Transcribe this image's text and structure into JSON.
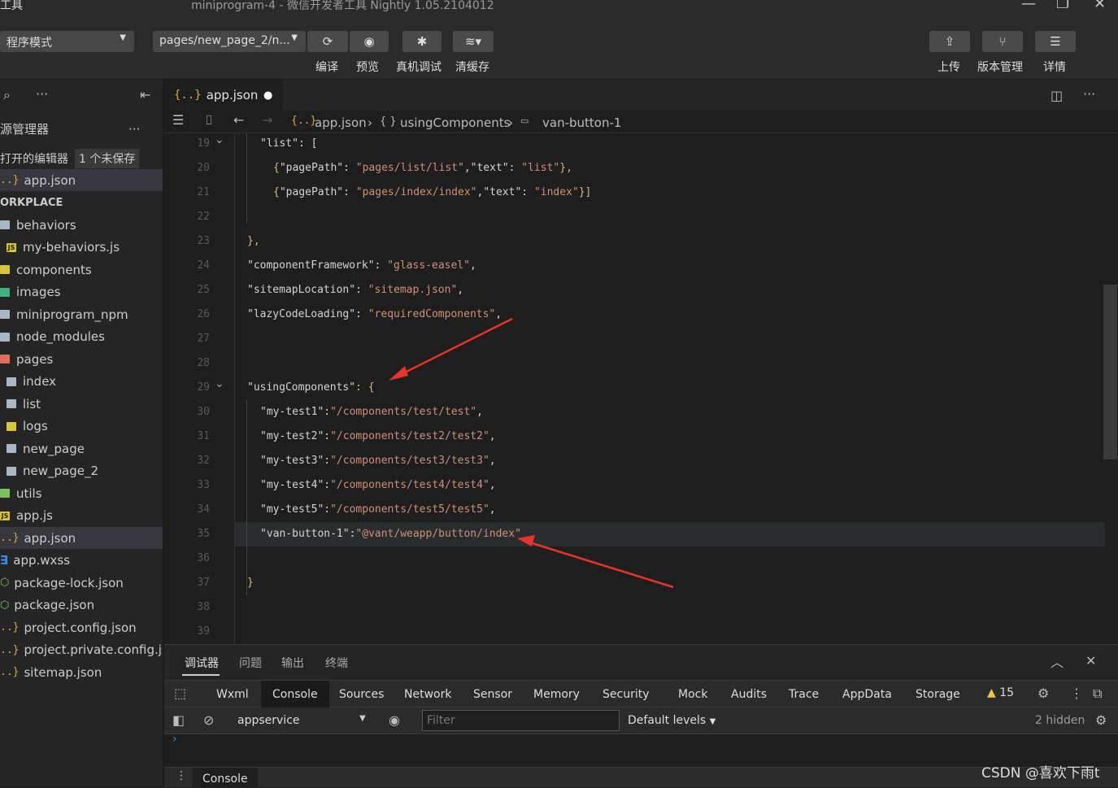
{
  "window": {
    "title_left": "工具",
    "title": "miniprogram-4 - 微信开发者工具 Nightly 1.05.2104012"
  },
  "toolbar": {
    "mode_select": "程序模式",
    "page_select": "pages/new_page_2/n...",
    "compile_label": "编译",
    "preview_label": "预览",
    "remote_debug_label": "真机调试",
    "clear_cache_label": "清缓存",
    "upload_label": "上传",
    "version_label": "版本管理",
    "details_label": "详情"
  },
  "sidebar": {
    "explorer_title": "源管理器",
    "open_editors_label": "打开的编辑器",
    "unsaved_badge": "1 个未保存",
    "open_file": "app.json",
    "workspace_label": "ORKPLACE",
    "items": [
      {
        "label": "behaviors",
        "type": "folder",
        "indent": 0
      },
      {
        "label": "my-behaviors.js",
        "type": "js",
        "indent": 1
      },
      {
        "label": "components",
        "type": "comp",
        "indent": 0
      },
      {
        "label": "images",
        "type": "img",
        "indent": 0
      },
      {
        "label": "miniprogram_npm",
        "type": "folder",
        "indent": 0
      },
      {
        "label": "node_modules",
        "type": "folder",
        "indent": 0
      },
      {
        "label": "pages",
        "type": "pg",
        "indent": 0
      },
      {
        "label": "index",
        "type": "folder",
        "indent": 1
      },
      {
        "label": "list",
        "type": "folder",
        "indent": 1
      },
      {
        "label": "logs",
        "type": "logs",
        "indent": 1
      },
      {
        "label": "new_page",
        "type": "folder",
        "indent": 1
      },
      {
        "label": "new_page_2",
        "type": "folder",
        "indent": 1
      },
      {
        "label": "utils",
        "type": "utils",
        "indent": 0
      },
      {
        "label": "app.js",
        "type": "js",
        "indent": 0
      },
      {
        "label": "app.json",
        "type": "json",
        "indent": 0,
        "selected": true
      },
      {
        "label": "app.wxss",
        "type": "css",
        "indent": 0
      },
      {
        "label": "package-lock.json",
        "type": "npm",
        "indent": 0
      },
      {
        "label": "package.json",
        "type": "npm",
        "indent": 0
      },
      {
        "label": "project.config.json",
        "type": "json",
        "indent": 0
      },
      {
        "label": "project.private.config.json",
        "type": "json",
        "indent": 0
      },
      {
        "label": "sitemap.json",
        "type": "json",
        "indent": 0
      }
    ]
  },
  "editor": {
    "tab_label": "app.json",
    "breadcrumb": [
      "app.json",
      "usingComponents",
      "van-button-1"
    ],
    "line_numbers": [
      "19",
      "20",
      "21",
      "22",
      "23",
      "24",
      "25",
      "26",
      "27",
      "28",
      "29",
      "30",
      "31",
      "32",
      "33",
      "34",
      "35",
      "36",
      "37",
      "38",
      "39"
    ],
    "lines": [
      {
        "n": "19",
        "indent": 1,
        "text": "\"list\": ["
      },
      {
        "n": "20",
        "indent": 2,
        "text": "{\"pagePath\": \"pages/list/list\",\"text\": \"list\"},"
      },
      {
        "n": "21",
        "indent": 2,
        "text": "{\"pagePath\": \"pages/index/index\",\"text\": \"index\"}]"
      },
      {
        "n": "22",
        "indent": 0,
        "text": ""
      },
      {
        "n": "23",
        "indent": 0,
        "text": "},"
      },
      {
        "n": "24",
        "indent": 0,
        "text": "\"componentFramework\": \"glass-easel\","
      },
      {
        "n": "25",
        "indent": 0,
        "text": "\"sitemapLocation\": \"sitemap.json\","
      },
      {
        "n": "26",
        "indent": 0,
        "text": "\"lazyCodeLoading\": \"requiredComponents\","
      },
      {
        "n": "27",
        "indent": 0,
        "text": ""
      },
      {
        "n": "28",
        "indent": 0,
        "text": ""
      },
      {
        "n": "29",
        "indent": 0,
        "text": "\"usingComponents\": {"
      },
      {
        "n": "30",
        "indent": 1,
        "text": "\"my-test1\":\"/components/test/test\","
      },
      {
        "n": "31",
        "indent": 1,
        "text": "\"my-test2\":\"/components/test2/test2\","
      },
      {
        "n": "32",
        "indent": 1,
        "text": "\"my-test3\":\"/components/test3/test3\","
      },
      {
        "n": "33",
        "indent": 1,
        "text": "\"my-test4\":\"/components/test4/test4\","
      },
      {
        "n": "34",
        "indent": 1,
        "text": "\"my-test5\":\"/components/test5/test5\","
      },
      {
        "n": "35",
        "indent": 1,
        "text": "\"van-button-1\":\"@vant/weapp/button/index\""
      },
      {
        "n": "36",
        "indent": 0,
        "text": ""
      },
      {
        "n": "37",
        "indent": 0,
        "text": "}"
      },
      {
        "n": "38",
        "indent": 0,
        "text": ""
      },
      {
        "n": "39",
        "indent": 0,
        "text": ""
      }
    ]
  },
  "panel": {
    "tabs": [
      "调试器",
      "问题",
      "输出",
      "终端"
    ],
    "devtools_tabs": [
      "Wxml",
      "Console",
      "Sources",
      "Network",
      "Sensor",
      "Memory",
      "Security",
      "Mock",
      "Audits",
      "Trace",
      "AppData",
      "Storage"
    ],
    "active_devtab": "Console",
    "warning_count": "15",
    "context_select": "appservice",
    "filter_placeholder": "Filter",
    "levels_label": "Default levels",
    "hidden_label": "2 hidden",
    "drawer_tab": "Console",
    "watermark": "CSDN @喜欢下雨t"
  },
  "colors": {
    "accent_arrow": "#e8332b",
    "string": "#ce9178"
  }
}
